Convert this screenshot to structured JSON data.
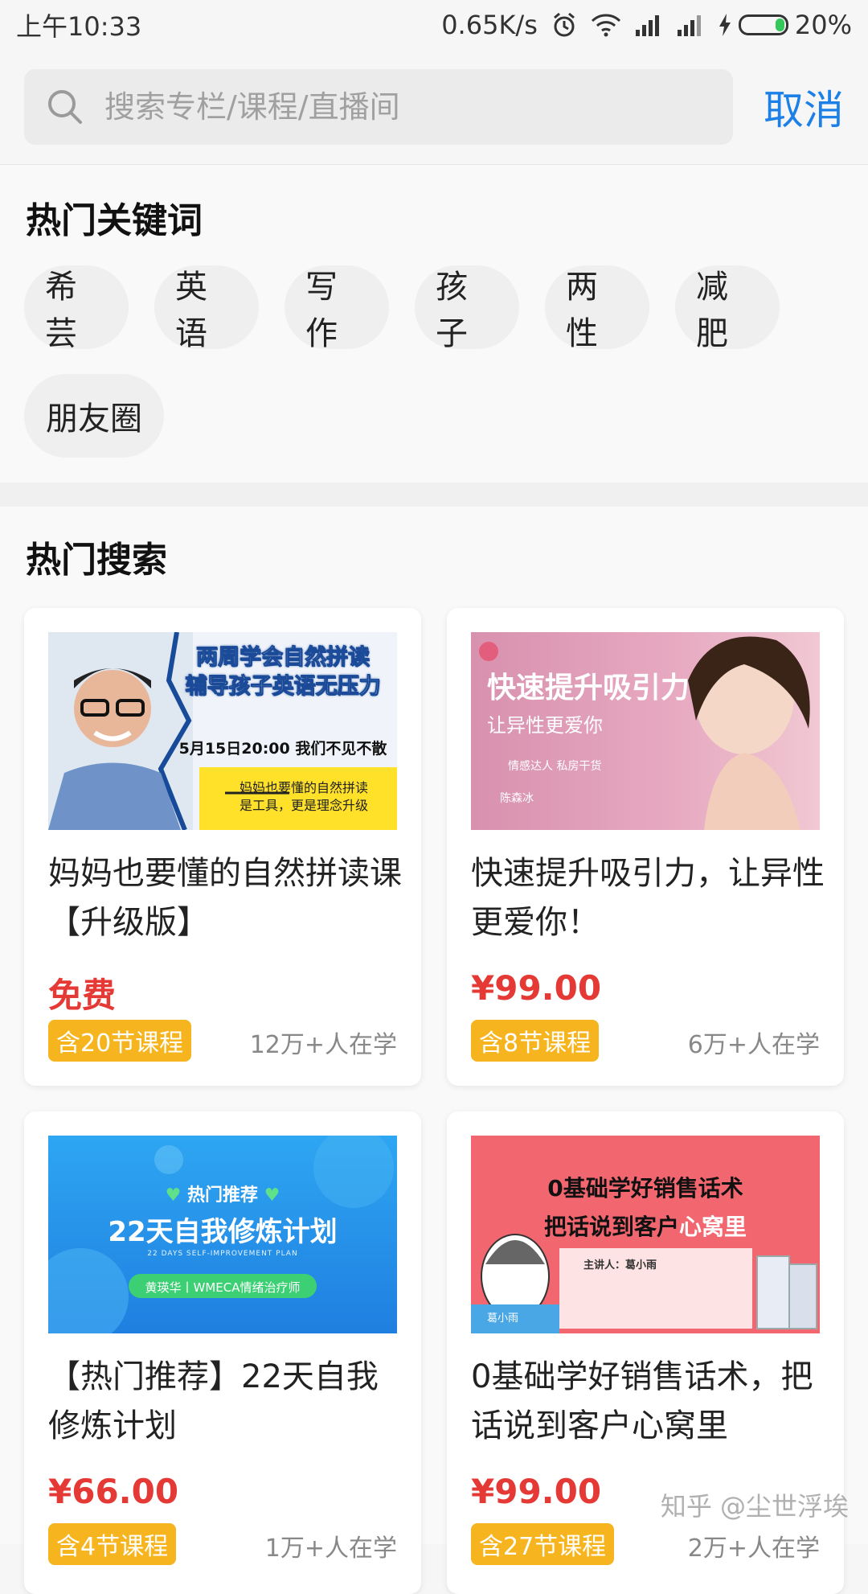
{
  "status_bar": {
    "time": "上午10:33",
    "network_speed": "0.65K/s",
    "battery_percent": "20%",
    "battery_level": 0.2
  },
  "search": {
    "placeholder": "搜索专栏/课程/直播间",
    "cancel_label": "取消"
  },
  "hot_keywords": {
    "title": "热门关键词",
    "items": [
      "希芸",
      "英语",
      "写作",
      "孩子",
      "两性",
      "减肥",
      "朋友圈"
    ]
  },
  "hot_search": {
    "title": "热门搜索",
    "cards": [
      {
        "title": "妈妈也要懂的自然拼读课【升级版】",
        "price": "免费",
        "lessons": "含20节课程",
        "learners": "12万+人在学",
        "thumb": {
          "line1": "两周学会自然拼读",
          "line2": "辅导孩子英语无压力",
          "date": "5月15日20:00 我们不见不散",
          "tag1": "妈妈也要懂的自然拼读",
          "tag2": "是工具，更是理念升级"
        }
      },
      {
        "title": "快速提升吸引力，让异性更爱你！",
        "price": "¥99.00",
        "lessons": "含8节课程",
        "learners": "6万+人在学",
        "thumb": {
          "headline": "快速提升吸引力",
          "sub": "让异性更爱你",
          "small": "情感达人 私房干货",
          "author": "陈森冰"
        }
      },
      {
        "title": "【热门推荐】22天自我修炼计划",
        "price": "¥66.00",
        "lessons": "含4节课程",
        "learners": "1万+人在学",
        "thumb": {
          "tag": "热门推荐",
          "headline": "22天自我修炼计划",
          "english": "22 DAYS SELF-IMPROVEMENT PLAN",
          "speaker": "黄瑛华丨WMECA情绪治疗师"
        }
      },
      {
        "title": "0基础学好销售话术，把话说到客户心窝里",
        "price": "¥99.00",
        "lessons": "含27节课程",
        "learners": "2万+人在学",
        "thumb": {
          "headline1": "0基础学好销售话术",
          "headline2a": "把话说到客户",
          "headline2b": "心窝里",
          "speaker": "主讲人：葛小雨",
          "name": "葛小雨"
        }
      }
    ]
  },
  "watermark": "知乎 @尘世浮埃",
  "colors": {
    "accent": "#1c80e6",
    "price": "#e53935",
    "badge": "#f6b51e"
  }
}
